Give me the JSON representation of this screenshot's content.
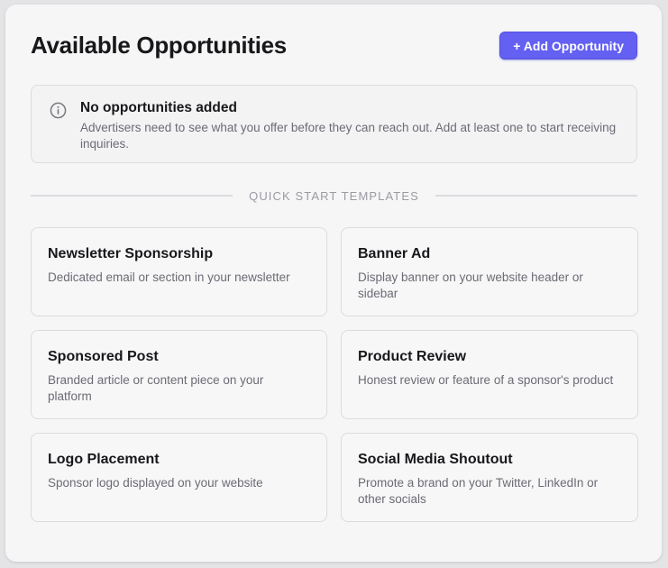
{
  "header": {
    "title": "Available Opportunities",
    "add_button_label": "+ Add Opportunity"
  },
  "notice": {
    "icon": "info-circle-icon",
    "title": "No opportunities added",
    "body": "Advertisers need to see what you offer before they can reach out. Add at least one to start receiving inquiries."
  },
  "divider": {
    "label": "QUICK START TEMPLATES"
  },
  "templates": [
    {
      "title": "Newsletter Sponsorship",
      "description": "Dedicated email or section in your newsletter"
    },
    {
      "title": "Banner Ad",
      "description": "Display banner on your website header or sidebar"
    },
    {
      "title": "Sponsored Post",
      "description": "Branded article or content piece on your platform"
    },
    {
      "title": "Product Review",
      "description": "Honest review or feature of a sponsor's product"
    },
    {
      "title": "Logo Placement",
      "description": "Sponsor logo displayed on your website"
    },
    {
      "title": "Social Media Shoutout",
      "description": "Promote a brand on your Twitter, LinkedIn or other socials"
    }
  ],
  "colors": {
    "accent": "#6360f2",
    "background": "#f6f6f7",
    "border": "#dcdce0",
    "muted_text": "#6b6b74"
  }
}
